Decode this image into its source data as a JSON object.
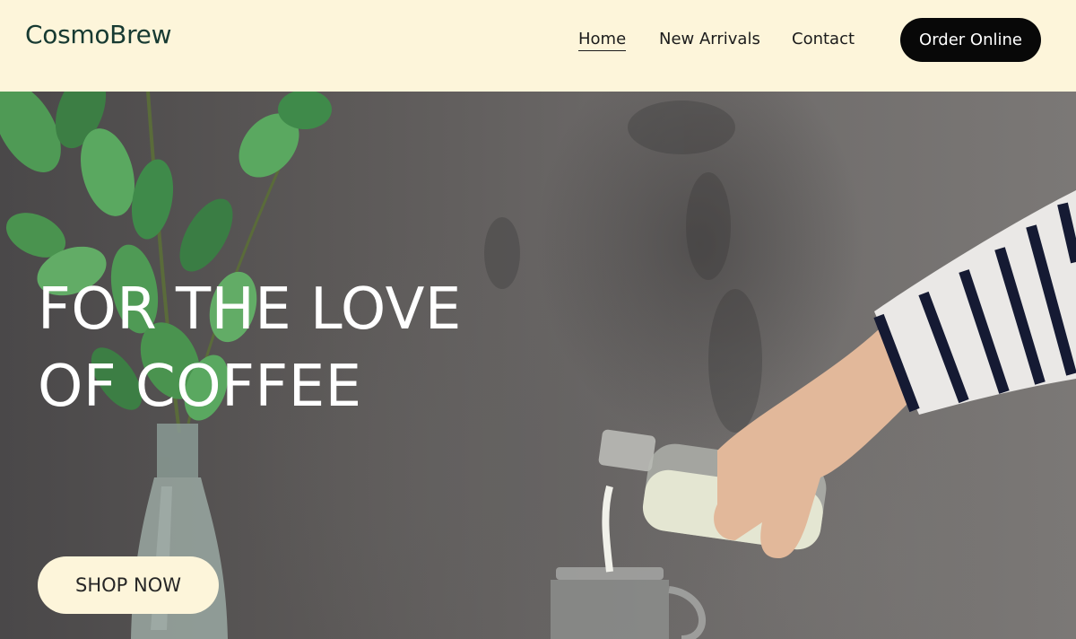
{
  "brand": {
    "name": "CosmoBrew"
  },
  "nav": {
    "items": [
      {
        "label": "Home",
        "active": true
      },
      {
        "label": "New Arrivals",
        "active": false
      },
      {
        "label": "Contact",
        "active": false
      }
    ],
    "cta_label": "Order Online"
  },
  "hero": {
    "title_line1": "FOR THE LOVE",
    "title_line2": "OF COFFEE",
    "cta_label": "SHOP NOW"
  },
  "colors": {
    "header_bg": "#fdf5da",
    "brand_text": "#173a32",
    "cta_dark": "#080808",
    "cta_light": "#fdf5da"
  }
}
